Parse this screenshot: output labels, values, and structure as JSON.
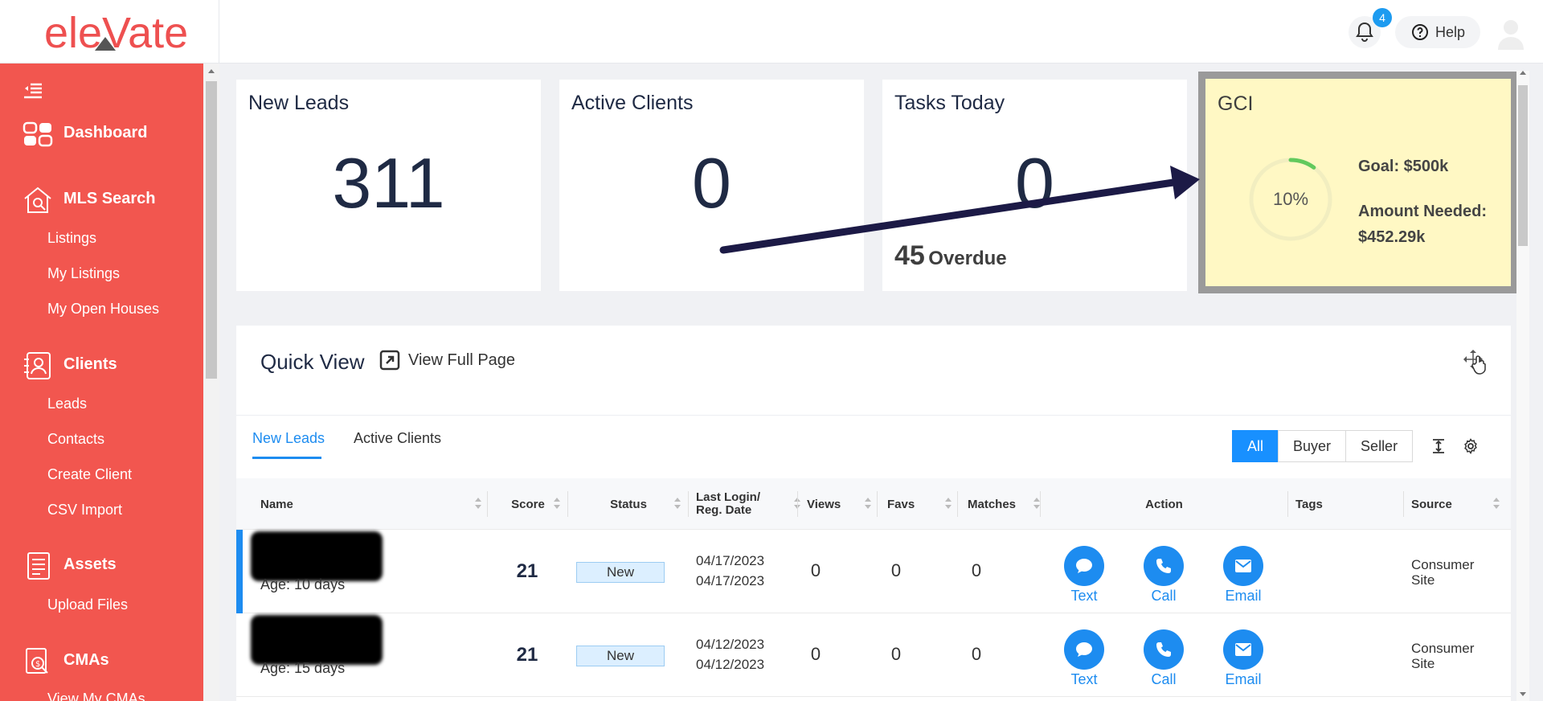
{
  "app": {
    "logo_text": "eleVate"
  },
  "header": {
    "notification_count": "4",
    "help_label": "Help"
  },
  "sidebar": {
    "sections": [
      {
        "label": "Dashboard",
        "icon": "dashboard-icon"
      },
      {
        "label": "MLS Search",
        "icon": "house-search-icon"
      },
      {
        "label": "Clients",
        "icon": "clients-icon"
      },
      {
        "label": "Assets",
        "icon": "document-icon"
      },
      {
        "label": "CMAs",
        "icon": "cma-icon"
      }
    ],
    "mls_items": [
      "Listings",
      "My Listings",
      "My Open Houses"
    ],
    "client_items": [
      "Leads",
      "Contacts",
      "Create Client",
      "CSV Import"
    ],
    "asset_items": [
      "Upload Files"
    ],
    "cma_items": [
      "View My CMAs"
    ]
  },
  "cards": {
    "new_leads": {
      "title": "New Leads",
      "value": "311"
    },
    "active_clients": {
      "title": "Active Clients",
      "value": "0"
    },
    "tasks_today": {
      "title": "Tasks Today",
      "value": "0",
      "overdue_count": "45",
      "overdue_label": "Overdue"
    },
    "gci": {
      "title": "GCI",
      "percent_label": "10%",
      "progress": 0.1,
      "goal": "Goal: $500k",
      "amount_needed": "Amount Needed: $452.29k"
    }
  },
  "quick_view": {
    "title": "Quick View",
    "view_full_page": "View Full Page",
    "tabs": [
      "New Leads",
      "Active Clients"
    ],
    "filters": [
      "All",
      "Buyer",
      "Seller"
    ],
    "active_filter": "All",
    "columns": [
      "Name",
      "Score",
      "Status",
      "Last Login/\nReg. Date",
      "Views",
      "Favs",
      "Matches",
      "Action",
      "Tags",
      "Source"
    ],
    "action_labels": {
      "text": "Text",
      "call": "Call",
      "email": "Email"
    },
    "rows": [
      {
        "age": "Age: 10 days",
        "score": "21",
        "status": "New",
        "last_login": "04/17/2023",
        "reg_date": "04/17/2023",
        "views": "0",
        "favs": "0",
        "matches": "0",
        "source_line1": "Consumer",
        "source_line2": "Site"
      },
      {
        "age": "Age: 15 days",
        "score": "21",
        "status": "New",
        "last_login": "04/12/2023",
        "reg_date": "04/12/2023",
        "views": "0",
        "favs": "0",
        "matches": "0",
        "source_line1": "Consumer",
        "source_line2": "Site"
      }
    ]
  },
  "colors": {
    "brand": "#f2564f",
    "accent": "#1d8cf0",
    "highlight": "#fff8c4",
    "arrow": "#1c1a46"
  }
}
